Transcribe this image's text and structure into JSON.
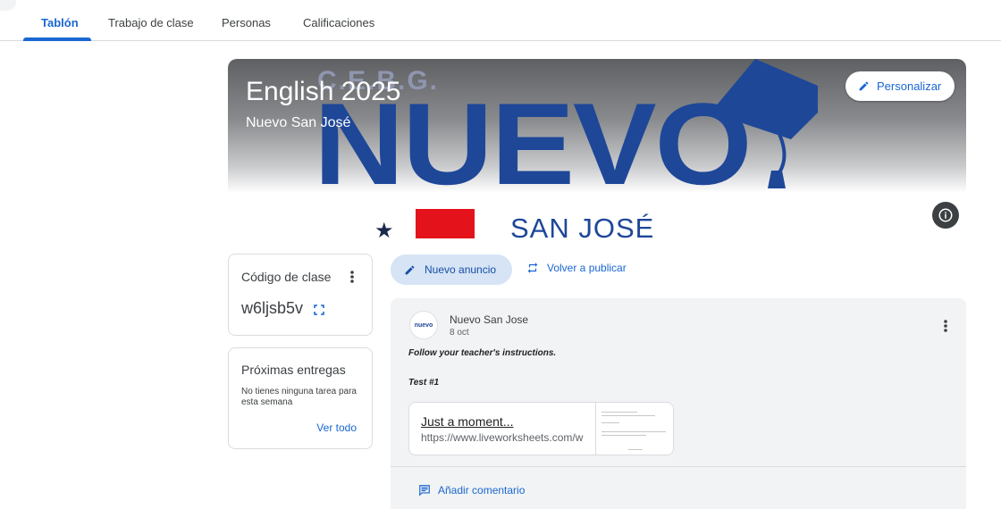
{
  "tabs": [
    {
      "label": "Tablón",
      "active": true
    },
    {
      "label": "Trabajo de clase",
      "active": false
    },
    {
      "label": "Personas",
      "active": false
    },
    {
      "label": "Calificaciones",
      "active": false
    }
  ],
  "banner": {
    "title": "English 2025",
    "subtitle": "Nuevo San José",
    "logo_top": "C.E.B.G.",
    "logo_main": "NUEVO",
    "logo_bottom": "SAN JOSÉ",
    "customize_label": "Personalizar",
    "info_icon": "info-icon"
  },
  "class_code": {
    "label": "Código de clase",
    "code": "w6ljsb5v"
  },
  "upcoming": {
    "label": "Próximas entregas",
    "description": "No tienes ninguna tarea para esta semana",
    "view_all": "Ver todo"
  },
  "actions": {
    "new_announcement": "Nuevo anuncio",
    "repost": "Volver a publicar"
  },
  "post": {
    "avatar_text": "nuevo",
    "author": "Nuevo San Jose",
    "date": "8 oct",
    "line1": "Follow your teacher's instructions.",
    "line2": "Test #1",
    "attachment": {
      "title": "Just a moment...",
      "url": "https://www.liveworksheets.com/w"
    },
    "comment_label": "Añadir comentario"
  },
  "colors": {
    "accent": "#1967d2",
    "logo_blue": "#1e4798",
    "flag_red": "#e3121b"
  }
}
